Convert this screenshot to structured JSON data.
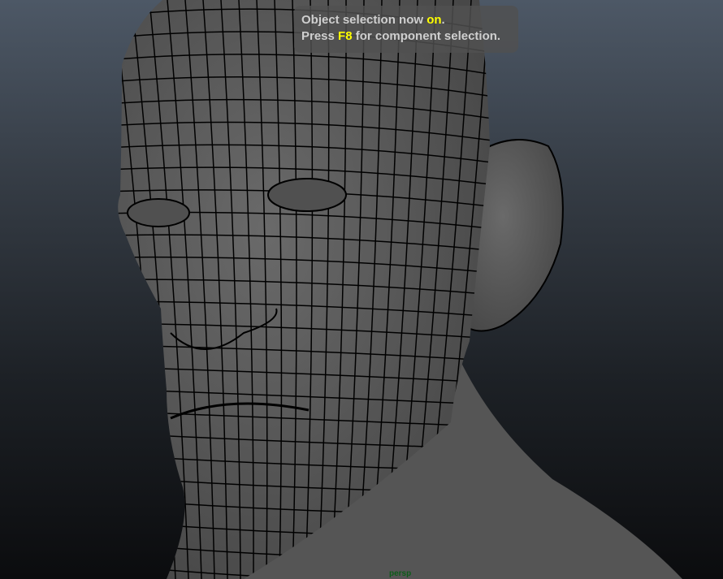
{
  "viewport": {
    "camera_label": "persp",
    "colors": {
      "mesh": "#5e5e5e",
      "wire": "#000000",
      "highlight": "#ffff00",
      "camera_label": "#0e5c1a"
    }
  },
  "tooltip": {
    "line1_prefix": "Object selection now ",
    "line1_highlight": "on",
    "line1_suffix": ".",
    "line2_prefix": "Press ",
    "line2_highlight": "F8",
    "line2_suffix": " for component selection."
  }
}
